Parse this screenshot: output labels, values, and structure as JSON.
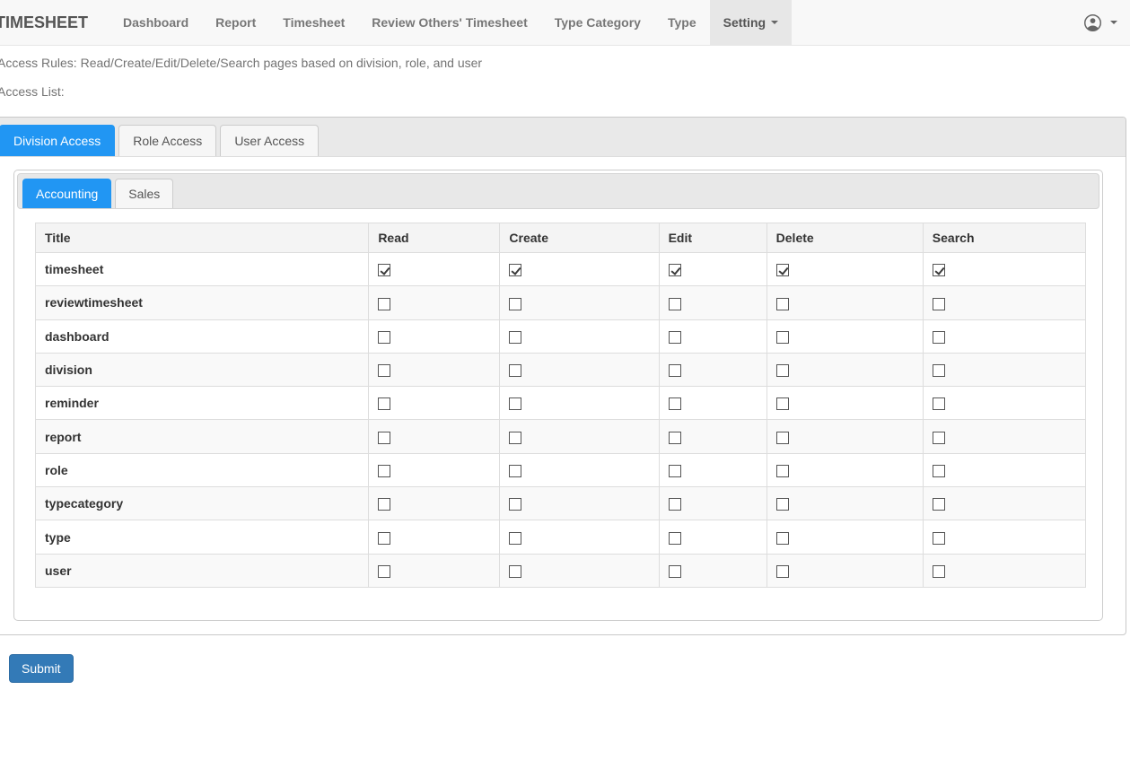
{
  "navbar": {
    "brand": "TIMESHEET",
    "items": [
      {
        "label": "Dashboard",
        "active": false,
        "caret": false
      },
      {
        "label": "Report",
        "active": false,
        "caret": false
      },
      {
        "label": "Timesheet",
        "active": false,
        "caret": false
      },
      {
        "label": "Review Others' Timesheet",
        "active": false,
        "caret": false
      },
      {
        "label": "Type Category",
        "active": false,
        "caret": false
      },
      {
        "label": "Type",
        "active": false,
        "caret": false
      },
      {
        "label": "Setting",
        "active": true,
        "caret": true
      }
    ],
    "user_menu": {
      "icon": "user-circle-icon",
      "caret_icon": "caret-down-icon"
    }
  },
  "intro": {
    "access_rules": "Access Rules: Read/Create/Edit/Delete/Search pages based on division, role, and user",
    "access_list": "Access List:"
  },
  "tabs": {
    "outer": [
      {
        "label": "Division Access",
        "active": true
      },
      {
        "label": "Role Access",
        "active": false
      },
      {
        "label": "User Access",
        "active": false
      }
    ],
    "inner": [
      {
        "label": "Accounting",
        "active": true
      },
      {
        "label": "Sales",
        "active": false
      }
    ]
  },
  "table": {
    "columns": [
      "Title",
      "Read",
      "Create",
      "Edit",
      "Delete",
      "Search"
    ],
    "rows": [
      {
        "title": "timesheet",
        "permissions": [
          true,
          true,
          true,
          true,
          true
        ]
      },
      {
        "title": "reviewtimesheet",
        "permissions": [
          false,
          false,
          false,
          false,
          false
        ]
      },
      {
        "title": "dashboard",
        "permissions": [
          false,
          false,
          false,
          false,
          false
        ]
      },
      {
        "title": "division",
        "permissions": [
          false,
          false,
          false,
          false,
          false
        ]
      },
      {
        "title": "reminder",
        "permissions": [
          false,
          false,
          false,
          false,
          false
        ]
      },
      {
        "title": "report",
        "permissions": [
          false,
          false,
          false,
          false,
          false
        ]
      },
      {
        "title": "role",
        "permissions": [
          false,
          false,
          false,
          false,
          false
        ]
      },
      {
        "title": "typecategory",
        "permissions": [
          false,
          false,
          false,
          false,
          false
        ]
      },
      {
        "title": "type",
        "permissions": [
          false,
          false,
          false,
          false,
          false
        ]
      },
      {
        "title": "user",
        "permissions": [
          false,
          false,
          false,
          false,
          false
        ]
      }
    ]
  },
  "submit": {
    "label": "Submit"
  },
  "colors": {
    "active_tab_blue": "#2196f3",
    "submit_blue": "#337ab7",
    "navbar_bg": "#f8f8f8",
    "navbar_active_bg": "#e7e7e7",
    "strip_gray": "#e9e9e9",
    "table_border": "#dddddd",
    "table_header_bg": "#f4f4f4",
    "table_stripe_bg": "#f9f9f9",
    "intro_text": "#737373"
  }
}
